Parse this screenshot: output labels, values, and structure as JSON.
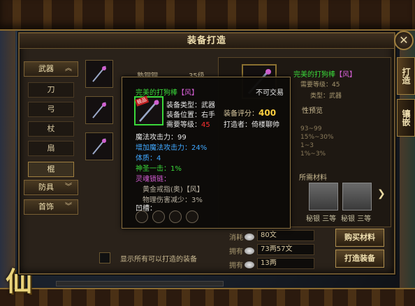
{
  "window": {
    "title": "装备打造",
    "close": "✕"
  },
  "side_tabs": [
    "打造",
    "镶嵌"
  ],
  "categories": {
    "weapon": "武器",
    "weapon_items": [
      "刀",
      "弓",
      "杖",
      "扇",
      "棍"
    ],
    "armor": "防具",
    "jewelry": "首饰"
  },
  "item_list": [
    {
      "name": "熟铜铜",
      "level": "35级"
    },
    {
      "name": "",
      "level": ""
    },
    {
      "name": "",
      "level": ""
    }
  ],
  "show_all_label": "显示所有可以打造的装备",
  "detail": {
    "name": "完美的打狗棒",
    "bracket": "【风】",
    "req": "需要等级：45",
    "type_label": "类型：武器",
    "preview_header": "性预览",
    "preview_lines": [
      "93~99",
      "15%~30%",
      "1~3",
      "1%~3%"
    ],
    "materials_header": "所需材料",
    "material_labels": [
      "秘银 三等",
      "秘银 三等"
    ],
    "next_arrow": "❯"
  },
  "costs": [
    {
      "label": "消耗",
      "value": "80文"
    },
    {
      "label": "拥有",
      "value": "73两57文"
    },
    {
      "label": "拥有",
      "value": "13两"
    }
  ],
  "buttons": {
    "buy": "购买材料",
    "forge": "打造装备"
  },
  "tooltip": {
    "name": "完美的打狗棒",
    "bracket": "【风】",
    "trade": "不可交易",
    "badge": "极品",
    "type": "装备类型：武器",
    "pos": "装备位置：右手",
    "req_label": "需要等级：",
    "req_value": "45",
    "score_label": "装备评分：",
    "score_value": "400",
    "maker": "打造者：倚楼聊帅",
    "stats": [
      {
        "text": "魔法攻击力：99",
        "cls": "stat-w"
      },
      {
        "text": "增加魔法攻击力：24%",
        "cls": "stat-b"
      },
      {
        "text": "体质：4",
        "cls": "stat-b"
      },
      {
        "text": "神圣一击：1%",
        "cls": "stat-g"
      },
      {
        "text": "灵魂锁链：",
        "cls": "stat-p"
      },
      {
        "text": "黄金戒指(奥)【风】",
        "cls": "stat-gray"
      },
      {
        "text": "物理伤害减少：3%",
        "cls": "stat-gray"
      }
    ],
    "sockets_label": "凹槽："
  },
  "logo": "仙途"
}
